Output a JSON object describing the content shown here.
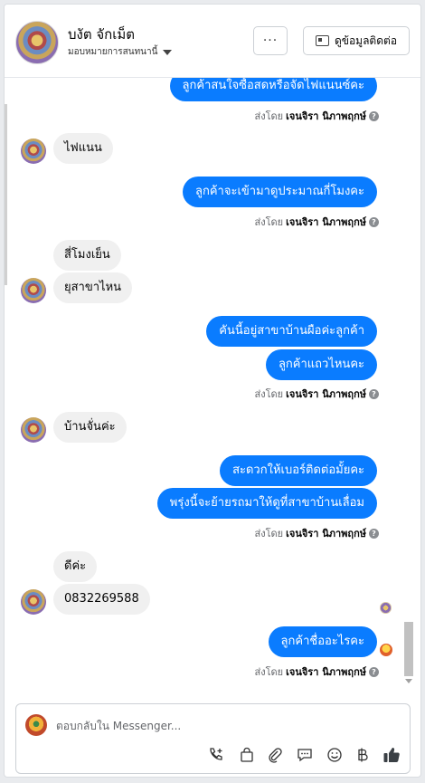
{
  "header": {
    "contact_name": "บงัต จักเม็ต",
    "assign_label": "มอบหมายการสนทนานี้",
    "more_label": "···",
    "info_label": "ดูข้อมูลติดต่อ"
  },
  "messages": [
    {
      "id": "m1",
      "dir": "out",
      "text": "ลูกค้าสนใจซื้อสดหรือจัดไฟแนนซ์คะ"
    },
    {
      "id": "s1",
      "dir": "sent_by",
      "prefix": "ส่งโดย",
      "agent": "เจนจิรา นิภาพฤกษ์"
    },
    {
      "id": "m2",
      "dir": "in",
      "text": "ไฟแนน"
    },
    {
      "id": "m3",
      "dir": "out",
      "text": "ลูกค้าจะเข้ามาดูประมาณกี่โมงคะ"
    },
    {
      "id": "s2",
      "dir": "sent_by",
      "prefix": "ส่งโดย",
      "agent": "เจนจิรา นิภาพฤกษ์"
    },
    {
      "id": "m4",
      "dir": "in",
      "text": "สี่โมงเย็น"
    },
    {
      "id": "m5",
      "dir": "in",
      "text": "ยุสาขาไหน"
    },
    {
      "id": "m6",
      "dir": "out",
      "text": "คันนี้อยู่สาขาบ้านผือค่ะลูกค้า"
    },
    {
      "id": "m7",
      "dir": "out",
      "text": "ลูกค้าแถวไหนคะ"
    },
    {
      "id": "s3",
      "dir": "sent_by",
      "prefix": "ส่งโดย",
      "agent": "เจนจิรา นิภาพฤกษ์"
    },
    {
      "id": "m8",
      "dir": "in",
      "text": "บ้านจั่นค่ะ"
    },
    {
      "id": "m9",
      "dir": "out",
      "text": "สะดวกให้เบอร์ติดต่อมั้ยคะ"
    },
    {
      "id": "m10",
      "dir": "out",
      "text": "พรุ่งนี้จะย้ายรถมาให้ดูที่สาขาบ้านเลื่อม"
    },
    {
      "id": "s4",
      "dir": "sent_by",
      "prefix": "ส่งโดย",
      "agent": "เจนจิรา นิภาพฤกษ์"
    },
    {
      "id": "m11",
      "dir": "in",
      "text": "ดีค่ะ"
    },
    {
      "id": "m12",
      "dir": "in",
      "text": "0832269588"
    },
    {
      "id": "m13",
      "dir": "out",
      "text": "ลูกค้าชื่ออะไรคะ"
    },
    {
      "id": "s5",
      "dir": "sent_by",
      "prefix": "ส่งโดย",
      "agent": "เจนจิรา นิภาพฤกษ์"
    }
  ],
  "composer": {
    "placeholder": "ตอบกลับใน Messenger...",
    "tools": [
      "call-add-icon",
      "shopping-bag-icon",
      "attachment-icon",
      "chat-bubble-icon",
      "emoji-icon",
      "baht-icon",
      "thumbs-up-icon"
    ]
  },
  "colors": {
    "outgoing_bubble": "#0a7cff",
    "incoming_bubble": "#f0f0f0",
    "like_button": "#3b4045"
  }
}
